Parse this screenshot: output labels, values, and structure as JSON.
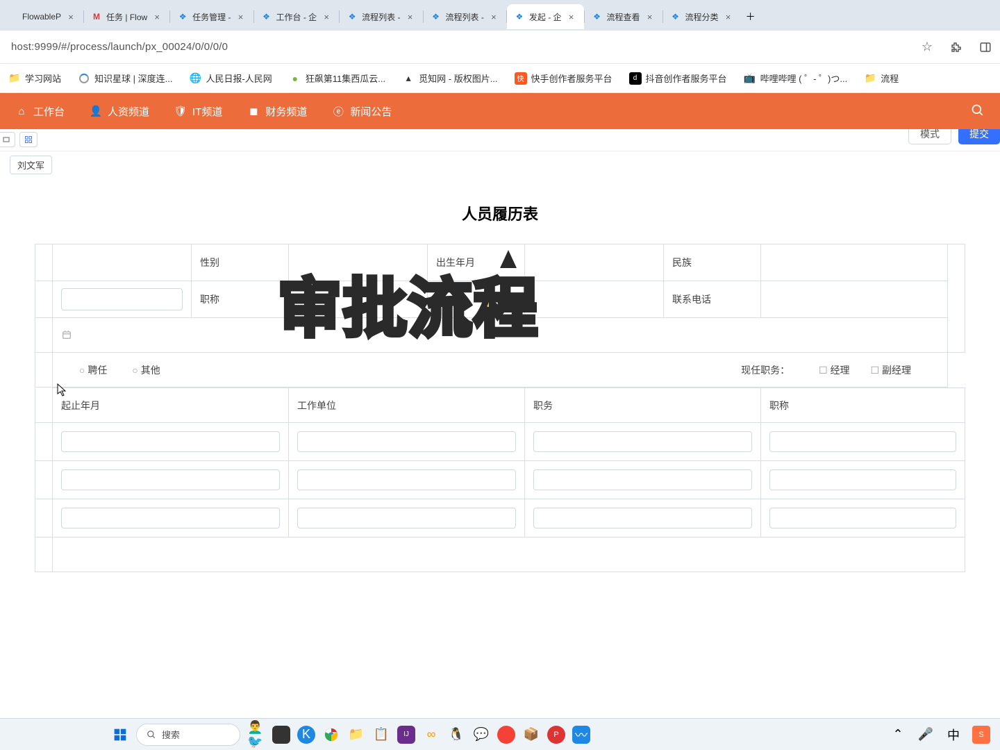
{
  "tabs": [
    {
      "title": "FlowableP",
      "favicon": ""
    },
    {
      "title": "任务 | Flow",
      "favicon": "M"
    },
    {
      "title": "任务管理 -",
      "favicon": "fan"
    },
    {
      "title": "工作台 - 企",
      "favicon": "fan"
    },
    {
      "title": "流程列表 -",
      "favicon": "fan"
    },
    {
      "title": "流程列表 -",
      "favicon": "fan"
    },
    {
      "title": "发起 - 企",
      "favicon": "fan",
      "active": true
    },
    {
      "title": "流程查看",
      "favicon": "fan"
    },
    {
      "title": "流程分类",
      "favicon": "fan"
    }
  ],
  "url": "host:9999/#/process/launch/px_00024/0/0/0/0",
  "bookmarks": [
    {
      "label": "学习网站",
      "icon": "folder"
    },
    {
      "label": "知识星球 | 深度连...",
      "icon": "circle"
    },
    {
      "label": "人民日报-人民网",
      "icon": "globe"
    },
    {
      "label": "狂飙第11集西瓜云...",
      "icon": "greenball"
    },
    {
      "label": "觅知网 - 版权图片...",
      "icon": "caret"
    },
    {
      "label": "快手创作者服务平台",
      "icon": "orangesq"
    },
    {
      "label": "抖音创作者服务平台",
      "icon": "blacksq"
    },
    {
      "label": "哔哩哔哩 ( ゜- ゜)つ...",
      "icon": "tv"
    },
    {
      "label": "流程",
      "icon": "folder"
    }
  ],
  "nav": [
    {
      "label": "工作台",
      "icon": "home"
    },
    {
      "label": "人资频道",
      "icon": "user"
    },
    {
      "label": "IT频道",
      "icon": "shield"
    },
    {
      "label": "财务频道",
      "icon": "wallet"
    },
    {
      "label": "新闻公告",
      "icon": "ie"
    }
  ],
  "sub": {
    "button1": "模式",
    "button2": "提交"
  },
  "user_tag": "刘文军",
  "form": {
    "title": "人员履历表",
    "labels": {
      "gender": "性别",
      "birth": "出生年月",
      "nation": "民族",
      "title": "职称",
      "phone": "联系电话"
    },
    "radio1": "聘任",
    "radio2": "其他",
    "position_label": "现任职务：",
    "position_opt1": "经理",
    "position_opt2": "副经理",
    "list_headers": [
      "起止年月",
      "工作单位",
      "职务",
      "职称"
    ]
  },
  "overlay_text": "审批流程",
  "taskbar": {
    "search": "搜索"
  }
}
